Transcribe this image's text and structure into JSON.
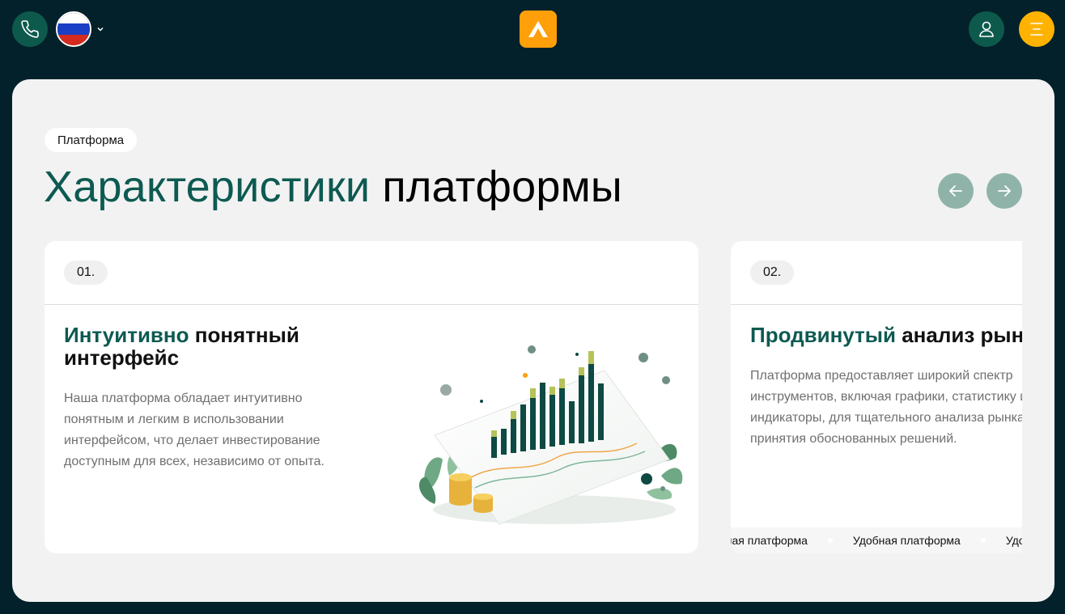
{
  "header": {
    "phone_icon": "phone-icon",
    "language": {
      "selected": "RU",
      "flag_colors": [
        "#ffffff",
        "#1a3fc4",
        "#d52b1e"
      ]
    },
    "logo_icon": "logo-a-icon",
    "user_icon": "user-icon",
    "menu_icon": "menu-icon"
  },
  "section": {
    "tag": "Платформа",
    "title_accent": "Характеристики",
    "title_rest": " платформы"
  },
  "cards": [
    {
      "number": "01.",
      "title_accent": "Интуитивно",
      "title_rest": " понятный интерфейс",
      "description": "Наша платформа обладает интуитивно понятным и легким в использовании интерфейсом, что делает инвестирование доступным для всех, независимо от опыта."
    },
    {
      "number": "02.",
      "title_accent": "Продвинутый",
      "title_rest": " анализ рынка",
      "description": "Платформа предоставляет широкий спектр инструментов, включая графики, статистику и индикаторы, для тщательного анализа рынка и принятия обоснованных решений."
    }
  ],
  "ticker": {
    "items": [
      "Удобная платформа",
      "Удобная платформа",
      "Удобная платформа"
    ]
  },
  "colors": {
    "page_bg": "#03212a",
    "accent_green": "#0d5a52",
    "accent_orange": "#ff9f0a",
    "menu_yellow": "#ffb300"
  }
}
